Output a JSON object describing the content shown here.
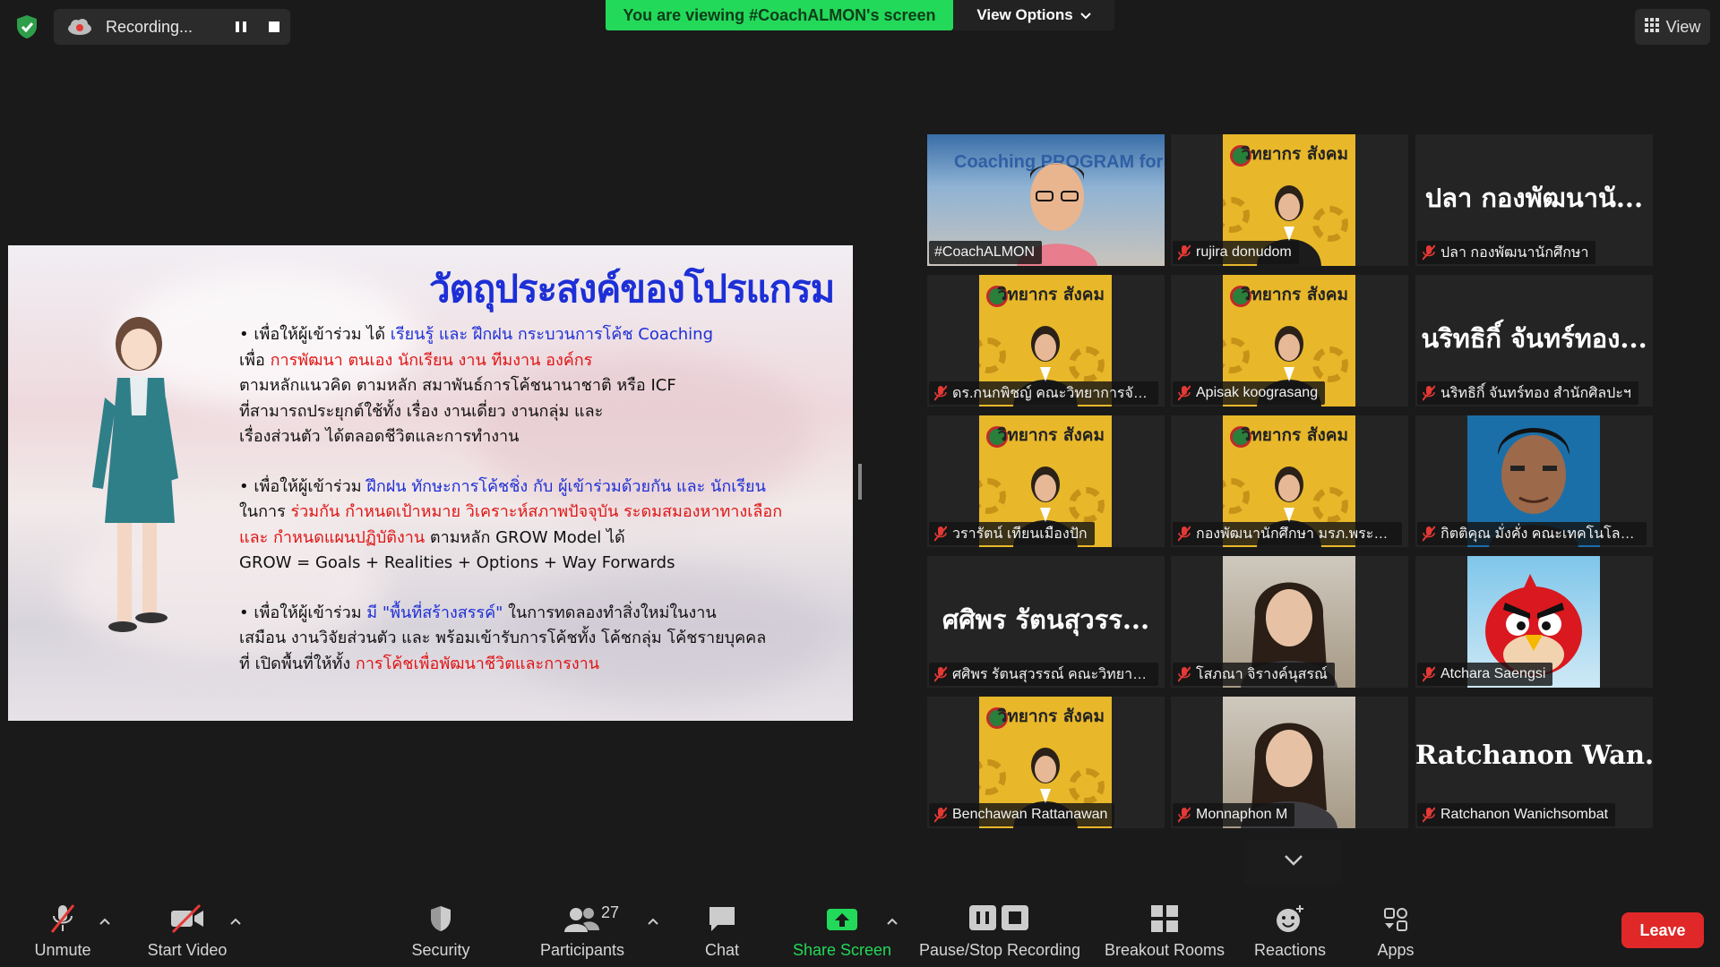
{
  "top": {
    "recording_label": "Recording...",
    "viewing_banner": "You are viewing #CoachALMON's screen",
    "view_options_label": "View Options",
    "view_label": "View"
  },
  "slide": {
    "title": "วัตถุประสงค์ของโปรแกรม",
    "p1": {
      "l1a": "• เพื่อให้ผู้เข้าร่วม ได้ ",
      "l1b": "เรียนรู้ และ ฝึกฝน กระบวนการโค้ช Coaching",
      "l2a": "เพื่อ ",
      "l2b": "การพัฒนา ตนเอง นักเรียน งาน ทีมงาน องค์กร",
      "l3": "ตามหลักแนวคิด ตามหลัก สมาพันธ์การโค้ชนานาชาติ หรือ ICF",
      "l4": "ที่สามารถประยุกต์ใช้ทั้ง เรื่อง งานเดี่ยว งานกลุ่ม และ",
      "l5": "เรื่องส่วนตัว ได้ตลอดชีวิตและการทำงาน"
    },
    "p2": {
      "l1a": "• เพื่อให้ผู้เข้าร่วม ",
      "l1b": "ฝึกฝน ทักษะการโค้ชชิ่ง กับ ผู้เข้าร่วมด้วยกัน และ นักเรียน",
      "l2a": "ในการ ",
      "l2b": "ร่วมกัน กำหนดเป้าหมาย วิเคราะห์สภาพปัจจุบัน ระดมสมองหาทางเลือก",
      "l3a": "และ กำหนดแผนปฏิบัติงาน",
      "l3b": " ตามหลัก GROW Model ได้",
      "l4": "GROW = Goals + Realities + Options + Way Forwards"
    },
    "p3": {
      "l1a": "• เพื่อให้ผู้เข้าร่วม ",
      "l1b": "มี \"พื้นที่สร้างสรรค์\"",
      "l1c": " ในการทดลองทำสิ่งใหม่ในงาน",
      "l2": "เสมือน งานวิจัยส่วนตัว และ พร้อมเข้ารับการโค้ชทั้ง โค้ชกลุ่ม โค้ชรายบุคคล",
      "l3a": "ที่ เปิดพื้นที่ให้ทั้ง ",
      "l3b": "การโค้ชเพื่อพัฒนาชีวิตและการงาน"
    }
  },
  "gallery": [
    {
      "name": "#CoachALMON",
      "kind": "video",
      "active": true,
      "muted": false,
      "poster_text": "Coaching PROGRAM for"
    },
    {
      "name": "rujira donudom",
      "kind": "poster",
      "muted": true,
      "poster_text": "วิทยากร สังคม"
    },
    {
      "name": "ปลา กองพัฒนานักศึกษา",
      "kind": "name",
      "muted": true,
      "display_name": "ปลา กองพัฒนานั..."
    },
    {
      "name": "ดร.กนกพิชญ์ คณะวิทยาการจัด...",
      "kind": "poster",
      "muted": true,
      "poster_text": "วิทยากร สังคม"
    },
    {
      "name": "Apisak koograsang",
      "kind": "poster",
      "muted": true,
      "poster_text": "วิทยากร สังคม"
    },
    {
      "name": "นริทธิกิ์ จันทร์ทอง สำนักศิลปะฯ",
      "kind": "name",
      "muted": true,
      "display_name": "นริทธิกิ์ จันทร์ทอง..."
    },
    {
      "name": "วรารัตน์ เทียนเมืองปัก",
      "kind": "poster",
      "muted": true,
      "poster_text": "วิทยากร สังคม"
    },
    {
      "name": "กองพัฒนานักศึกษา มรภ.พระนคร",
      "kind": "poster",
      "muted": true,
      "poster_text": "วิทยากร สังคม"
    },
    {
      "name": "กิตติคุณ มั่งคั่ง คณะเทคโนโลยีอุ...",
      "kind": "portrait",
      "muted": true
    },
    {
      "name": "ศศิพร รัตนสุวรรณ์ คณะวิทยาศ...",
      "kind": "name",
      "muted": true,
      "display_name": "ศศิพร รัตนสุวรร..."
    },
    {
      "name": "โสภณา จิรางค์นุสรณ์",
      "kind": "photo",
      "muted": true
    },
    {
      "name": "Atchara Saengsi",
      "kind": "bird",
      "muted": true
    },
    {
      "name": "Benchawan Rattanawan",
      "kind": "poster",
      "muted": true,
      "poster_text": "วิทยากร สังคม"
    },
    {
      "name": "Monnaphon M",
      "kind": "photo",
      "muted": true
    },
    {
      "name": "Ratchanon Wanichsombat",
      "kind": "name",
      "muted": true,
      "display_name": "Ratchanon Wan..."
    }
  ],
  "toolbar": {
    "unmute": "Unmute",
    "start_video": "Start Video",
    "security": "Security",
    "participants": "Participants",
    "participants_count": "27",
    "chat": "Chat",
    "share_screen": "Share Screen",
    "pause_stop_recording": "Pause/Stop Recording",
    "breakout_rooms": "Breakout Rooms",
    "reactions": "Reactions",
    "apps": "Apps",
    "leave": "Leave"
  },
  "colors": {
    "banner_green": "#23d959",
    "active_speaker": "#c8f03c",
    "leave_red": "#e02828",
    "mute_red": "#e53935",
    "slide_blue": "#1d2fd6",
    "slide_red": "#e01515",
    "poster_yellow": "#e8b82a"
  }
}
